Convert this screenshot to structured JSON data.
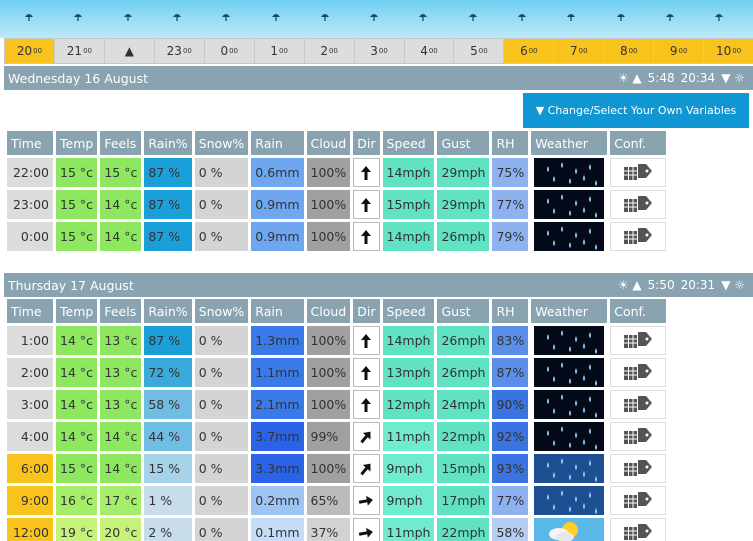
{
  "timeline": {
    "hours": [
      {
        "h": "20",
        "day": true
      },
      {
        "h": "21",
        "day": false
      },
      {
        "h": "▲",
        "day": false,
        "arrow": true
      },
      {
        "h": "23",
        "day": false
      },
      {
        "h": "0",
        "day": false
      },
      {
        "h": "1",
        "day": false
      },
      {
        "h": "2",
        "day": false
      },
      {
        "h": "3",
        "day": false
      },
      {
        "h": "4",
        "day": false
      },
      {
        "h": "5",
        "day": false
      },
      {
        "h": "6",
        "day": true
      },
      {
        "h": "7",
        "day": true
      },
      {
        "h": "8",
        "day": true
      },
      {
        "h": "9",
        "day": true
      },
      {
        "h": "10",
        "day": true
      }
    ],
    "minute_suffix": "00"
  },
  "variables_button": "▼ Change/Select Your Own Variables",
  "headers": [
    "Time",
    "Temp",
    "Feels",
    "Rain%",
    "Snow%",
    "Rain",
    "Cloud",
    "Dir",
    "Speed",
    "Gust",
    "RH",
    "Weather",
    "Conf."
  ],
  "days": [
    {
      "title": "Wednesday 16 August",
      "sunrise": "5:48",
      "sunset": "20:34",
      "rows": [
        {
          "time": "22:00",
          "day": false,
          "temp": "15 °c",
          "feels": "15 °c",
          "rainp": "87 %",
          "snow": "0 %",
          "rain": "0.6mm",
          "cloud": "100%",
          "dir": "↑",
          "speed": "14mph",
          "gust": "29mph",
          "rh": "75%",
          "wx": "night-rain"
        },
        {
          "time": "23:00",
          "day": false,
          "temp": "15 °c",
          "feels": "14 °c",
          "rainp": "87 %",
          "snow": "0 %",
          "rain": "0.9mm",
          "cloud": "100%",
          "dir": "↑",
          "speed": "15mph",
          "gust": "29mph",
          "rh": "77%",
          "wx": "night-rain"
        },
        {
          "time": "0:00",
          "day": false,
          "temp": "15 °c",
          "feels": "14 °c",
          "rainp": "87 %",
          "snow": "0 %",
          "rain": "0.9mm",
          "cloud": "100%",
          "dir": "↑",
          "speed": "14mph",
          "gust": "26mph",
          "rh": "79%",
          "wx": "night-rain"
        }
      ]
    },
    {
      "title": "Thursday 17 August",
      "sunrise": "5:50",
      "sunset": "20:31",
      "rows": [
        {
          "time": "1:00",
          "day": false,
          "temp": "14 °c",
          "feels": "13 °c",
          "rainp": "87 %",
          "snow": "0 %",
          "rain": "1.3mm",
          "cloud": "100%",
          "dir": "↑",
          "speed": "14mph",
          "gust": "26mph",
          "rh": "83%",
          "wx": "night-rain"
        },
        {
          "time": "2:00",
          "day": false,
          "temp": "14 °c",
          "feels": "13 °c",
          "rainp": "72 %",
          "snow": "0 %",
          "rain": "1.1mm",
          "cloud": "100%",
          "dir": "↑",
          "speed": "13mph",
          "gust": "26mph",
          "rh": "87%",
          "wx": "night-rain"
        },
        {
          "time": "3:00",
          "day": false,
          "temp": "14 °c",
          "feels": "13 °c",
          "rainp": "58 %",
          "snow": "0 %",
          "rain": "2.1mm",
          "cloud": "100%",
          "dir": "↑",
          "speed": "12mph",
          "gust": "24mph",
          "rh": "90%",
          "wx": "night-rain"
        },
        {
          "time": "4:00",
          "day": false,
          "temp": "14 °c",
          "feels": "14 °c",
          "rainp": "44 %",
          "snow": "0 %",
          "rain": "3.7mm",
          "cloud": "99%",
          "dir": "↗",
          "speed": "11mph",
          "gust": "22mph",
          "rh": "92%",
          "wx": "night-rain"
        },
        {
          "time": "6:00",
          "day": true,
          "temp": "15 °c",
          "feels": "14 °c",
          "rainp": "15 %",
          "snow": "0 %",
          "rain": "3.3mm",
          "cloud": "100%",
          "dir": "↗",
          "speed": "9mph",
          "gust": "15mph",
          "rh": "93%",
          "wx": "day-rain"
        },
        {
          "time": "9:00",
          "day": true,
          "temp": "16 °c",
          "feels": "17 °c",
          "rainp": "1 %",
          "snow": "0 %",
          "rain": "0.2mm",
          "cloud": "65%",
          "dir": "→",
          "speed": "9mph",
          "gust": "17mph",
          "rh": "77%",
          "wx": "day-rain"
        },
        {
          "time": "12:00",
          "day": true,
          "temp": "19 °c",
          "feels": "20 °c",
          "rainp": "2 %",
          "snow": "0 %",
          "rain": "0.1mm",
          "cloud": "37%",
          "dir": "→",
          "speed": "11mph",
          "gust": "22mph",
          "rh": "58%",
          "wx": "sunny-cloud"
        }
      ]
    }
  ],
  "colors": {
    "header": "#8aa3b0",
    "daytime": "#f8c31d",
    "button": "#1096d3"
  }
}
